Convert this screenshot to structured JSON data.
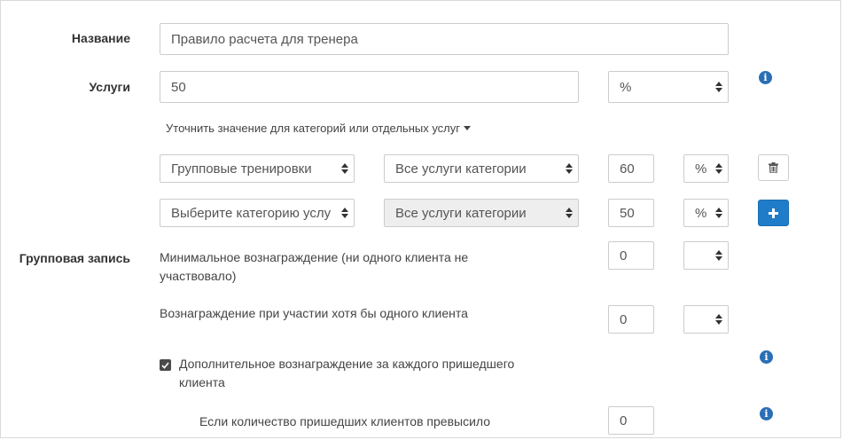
{
  "form": {
    "name_label": "Название",
    "name_value": "Правило расчета для тренера",
    "services_label": "Услуги",
    "services_value": "50",
    "services_unit": "%",
    "refine_link": "Уточнить значение для категорий или отдельных услуг",
    "rows": [
      {
        "category": "Групповые тренировки",
        "service": "Все услуги категории",
        "value": "60",
        "unit": "%"
      },
      {
        "category": "Выберите категорию услу",
        "service": "Все услуги категории",
        "value": "50",
        "unit": "%"
      }
    ],
    "group_label": "Групповая запись",
    "min_reward_label": "Минимальное вознаграждение (ни одного клиента не участвовало)",
    "min_reward_value": "0",
    "one_client_label": "Вознаграждение при участии хотя бы одного клиента",
    "one_client_value": "0",
    "extra_reward_label": "Дополнительное вознаграждение за каждого пришедшего клиента",
    "extra_reward_checked": true,
    "threshold_label": "Если количество пришедших клиентов превысило",
    "threshold_value": "0"
  },
  "icons": {
    "info": "info-icon",
    "trash": "trash-icon",
    "plus": "plus-icon",
    "caret": "caret-down-icon",
    "select_arrows": "select-arrows-icon"
  },
  "colors": {
    "accent": "#1f7cc9",
    "info": "#2a6fb5",
    "disabled_bg": "#eeeeee"
  }
}
